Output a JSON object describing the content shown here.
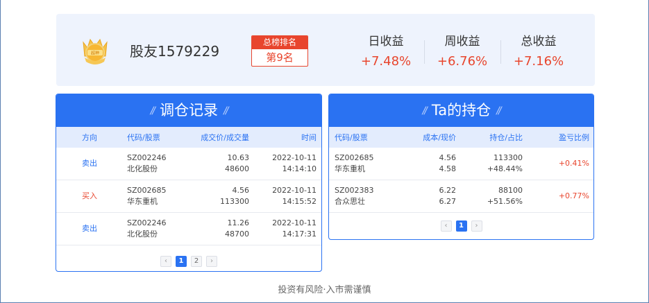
{
  "profile": {
    "username": "股友1579229",
    "rank_title": "总榜排名",
    "rank_value": "第9名",
    "stats": [
      {
        "label": "日收益",
        "value": "+7.48%"
      },
      {
        "label": "周收益",
        "value": "+6.76%"
      },
      {
        "label": "总收益",
        "value": "+7.16%"
      }
    ]
  },
  "trades": {
    "title": "调仓记录",
    "columns": [
      "方向",
      "代码/股票",
      "成交价/成交量",
      "时间"
    ],
    "rows": [
      {
        "direction": "卖出",
        "code": "SZ002246",
        "name": "北化股份",
        "price": "10.63",
        "volume": "48600",
        "date": "2022-10-11",
        "time": "14:14:10",
        "dir_color": "#2a72f2"
      },
      {
        "direction": "买入",
        "code": "SZ002685",
        "name": "华东重机",
        "price": "4.56",
        "volume": "113300",
        "date": "2022-10-11",
        "time": "14:15:52",
        "dir_color": "#e8452d"
      },
      {
        "direction": "卖出",
        "code": "SZ002246",
        "name": "北化股份",
        "price": "11.26",
        "volume": "48700",
        "date": "2022-10-11",
        "time": "14:17:31",
        "dir_color": "#2a72f2"
      }
    ],
    "pager": {
      "prev": "‹",
      "pages": [
        "1",
        "2"
      ],
      "next": "›"
    }
  },
  "holdings": {
    "title": "Ta的持仓",
    "columns": [
      "代码/股票",
      "成本/现价",
      "持仓/占比",
      "盈亏比例"
    ],
    "rows": [
      {
        "code": "SZ002685",
        "name": "华东重机",
        "cost": "4.56",
        "price": "4.58",
        "shares": "113300",
        "ratio": "+48.44%",
        "pnl": "+0.41%"
      },
      {
        "code": "SZ002383",
        "name": "合众思壮",
        "cost": "6.22",
        "price": "6.27",
        "shares": "88100",
        "ratio": "+51.56%",
        "pnl": "+0.77%"
      }
    ],
    "pager": {
      "prev": "‹",
      "pages": [
        "1"
      ],
      "next": "›"
    }
  },
  "footer": "投资有风险·入市需谨慎",
  "colors": {
    "accent": "#2a72f2",
    "up": "#e8452d",
    "card_bg": "#eef3fd"
  },
  "icons": {
    "badge": "gold-crown-medal-icon"
  }
}
